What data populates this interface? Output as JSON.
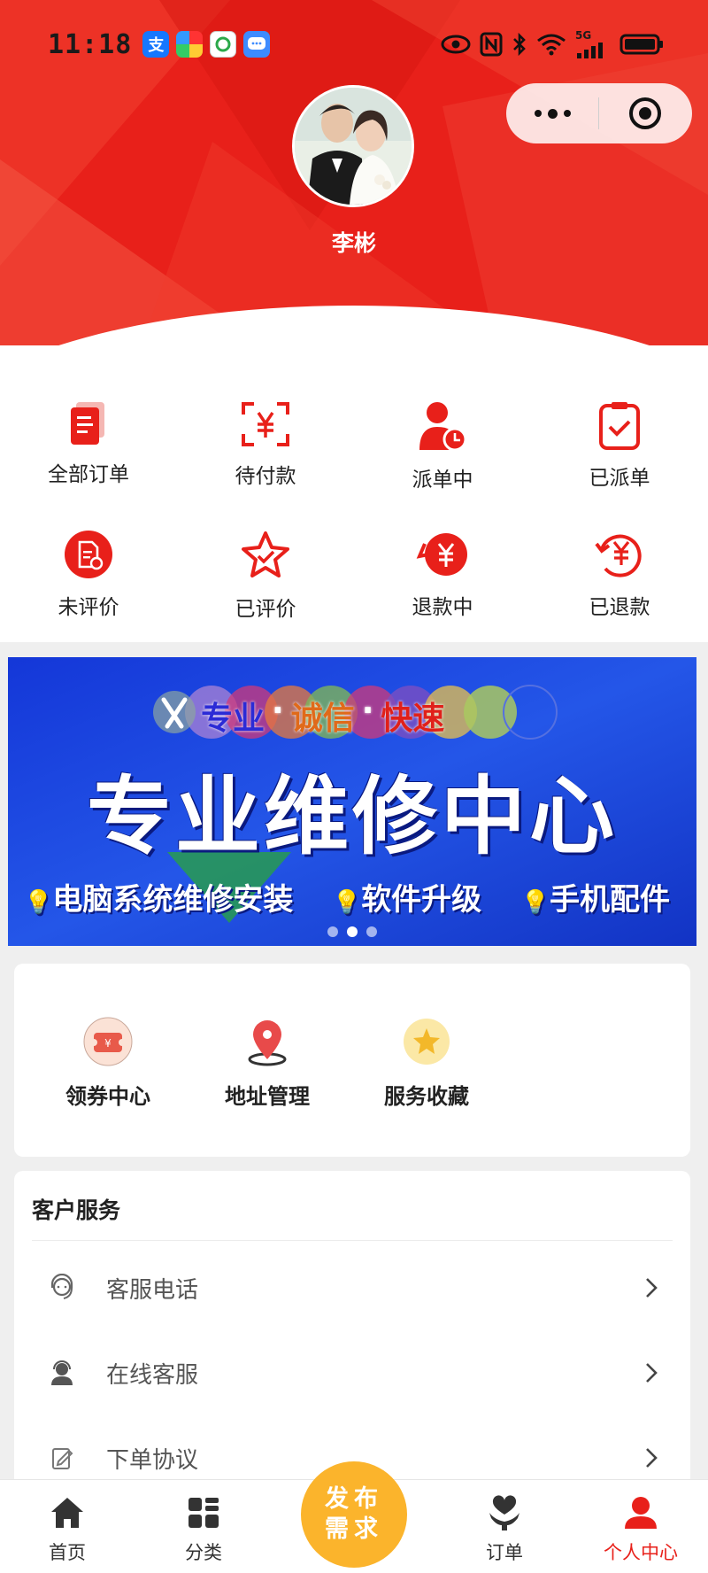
{
  "status_bar": {
    "time": "11:18",
    "network": "5G"
  },
  "header": {
    "username": "李彬"
  },
  "orders": [
    {
      "label": "全部订单",
      "icon": "document-list-icon"
    },
    {
      "label": "待付款",
      "icon": "yuan-scan-icon"
    },
    {
      "label": "派单中",
      "icon": "person-clock-icon"
    },
    {
      "label": "已派单",
      "icon": "clipboard-check-icon"
    },
    {
      "label": "未评价",
      "icon": "review-pending-icon"
    },
    {
      "label": "已评价",
      "icon": "star-check-icon"
    },
    {
      "label": "退款中",
      "icon": "refund-yuan-icon"
    },
    {
      "label": "已退款",
      "icon": "refund-done-icon"
    }
  ],
  "banner": {
    "slogan": [
      "专业",
      "诚信",
      "快速"
    ],
    "title": "专业维修中心",
    "features": [
      "电脑系统维修安装",
      "软件升级",
      "手机配件"
    ],
    "slide_count": 3,
    "active_slide": 2
  },
  "tools": [
    {
      "label": "领券中心",
      "icon": "coupon-icon"
    },
    {
      "label": "地址管理",
      "icon": "location-pin-icon"
    },
    {
      "label": "服务收藏",
      "icon": "star-favorite-icon"
    }
  ],
  "service": {
    "title": "客户服务",
    "items": [
      {
        "label": "客服电话",
        "icon": "headset-icon"
      },
      {
        "label": "在线客服",
        "icon": "agent-icon"
      },
      {
        "label": "下单协议",
        "icon": "edit-doc-icon"
      }
    ]
  },
  "tabbar": {
    "publish_label_1": "发布",
    "publish_label_2": "需求",
    "tabs": [
      {
        "label": "首页",
        "icon": "home-icon"
      },
      {
        "label": "分类",
        "icon": "grid-icon"
      },
      {
        "label": "订单",
        "icon": "heart-hand-icon"
      },
      {
        "label": "个人中心",
        "icon": "person-icon"
      }
    ]
  },
  "colors": {
    "brand_red": "#e8201a",
    "publish_orange": "#fbb42c",
    "banner_blue": "#1d3fd6"
  }
}
